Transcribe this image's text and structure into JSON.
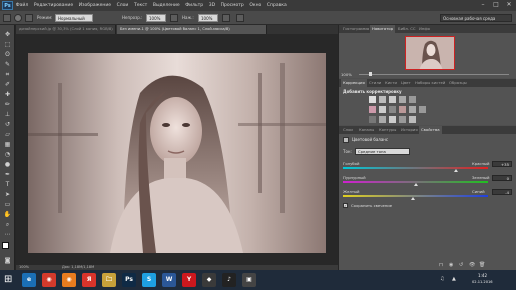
{
  "menubar": {
    "logo": "Ps",
    "items": [
      "Файл",
      "Редактирование",
      "Изображение",
      "Слои",
      "Текст",
      "Выделение",
      "Фильтр",
      "3D",
      "Просмотр",
      "Окно",
      "Справка"
    ],
    "window_controls": [
      "–",
      "□",
      "✕"
    ]
  },
  "options": {
    "mode_label": "Режим:",
    "mode_value": "Нормальный",
    "opacity_label": "Непрозр.:",
    "opacity_value": "100%",
    "flow_label": "Наж.:",
    "flow_value": "100%",
    "workspace": "Основная рабочая среда"
  },
  "document_tabs": [
    {
      "label": "дизайнерский.jp @ 30,3% (Слой 1 копия, RGB/8)",
      "active": false
    },
    {
      "label": "Без имени-1 @ 100% (Цветовой баланс 1, Слой-маска/8)",
      "active": true
    }
  ],
  "status": {
    "zoom": "100%",
    "doc": "Док: 1,18М/1,18М"
  },
  "navigator": {
    "tabs": [
      "Гистограмма",
      "Навигатор",
      "Библ. CC",
      "Инфо"
    ],
    "active_tab": "Навигатор",
    "zoom": "100%"
  },
  "adjustments": {
    "tabs": [
      "Коррекция",
      "Стили",
      "Кисти",
      "Цвет",
      "Наборы кистей",
      "Образцы"
    ],
    "active_tab": "Коррекция",
    "title": "Добавить корректировку"
  },
  "properties": {
    "tabs": [
      "Слои",
      "Каналы",
      "Контуры",
      "История",
      "Свойства"
    ],
    "active_tab": "Свойства",
    "layer_name": "Цветовой баланс",
    "tone_label": "Тон:",
    "tone_value": "Средние тона",
    "sliders": [
      {
        "left": "Голубой",
        "right": "Красный",
        "value": "+35",
        "position": 0.78
      },
      {
        "left": "Пурпурный",
        "right": "Зеленый",
        "value": "0",
        "position": 0.5
      },
      {
        "left": "Желтый",
        "right": "Синий",
        "value": "-4",
        "position": 0.48
      }
    ],
    "preserve_luminosity": "Сохранить свечение"
  },
  "taskbar": {
    "apps": [
      {
        "label": "e",
        "color": "#1b6fb5"
      },
      {
        "label": "◉",
        "color": "#d23a2c"
      },
      {
        "label": "◉",
        "color": "#e87c1f"
      },
      {
        "label": "Я",
        "color": "#d9342b"
      },
      {
        "label": "🗀",
        "color": "#c8a13a"
      },
      {
        "label": "Ps",
        "color": "#0f2a45"
      },
      {
        "label": "S",
        "color": "#1ea0e2"
      },
      {
        "label": "W",
        "color": "#2b5797"
      },
      {
        "label": "Y",
        "color": "#cc181e"
      },
      {
        "label": "◆",
        "color": "#3a3a3a"
      },
      {
        "label": "♪",
        "color": "#222"
      },
      {
        "label": "▣",
        "color": "#444"
      }
    ],
    "time": "1:42",
    "date": "02.11.2016"
  }
}
